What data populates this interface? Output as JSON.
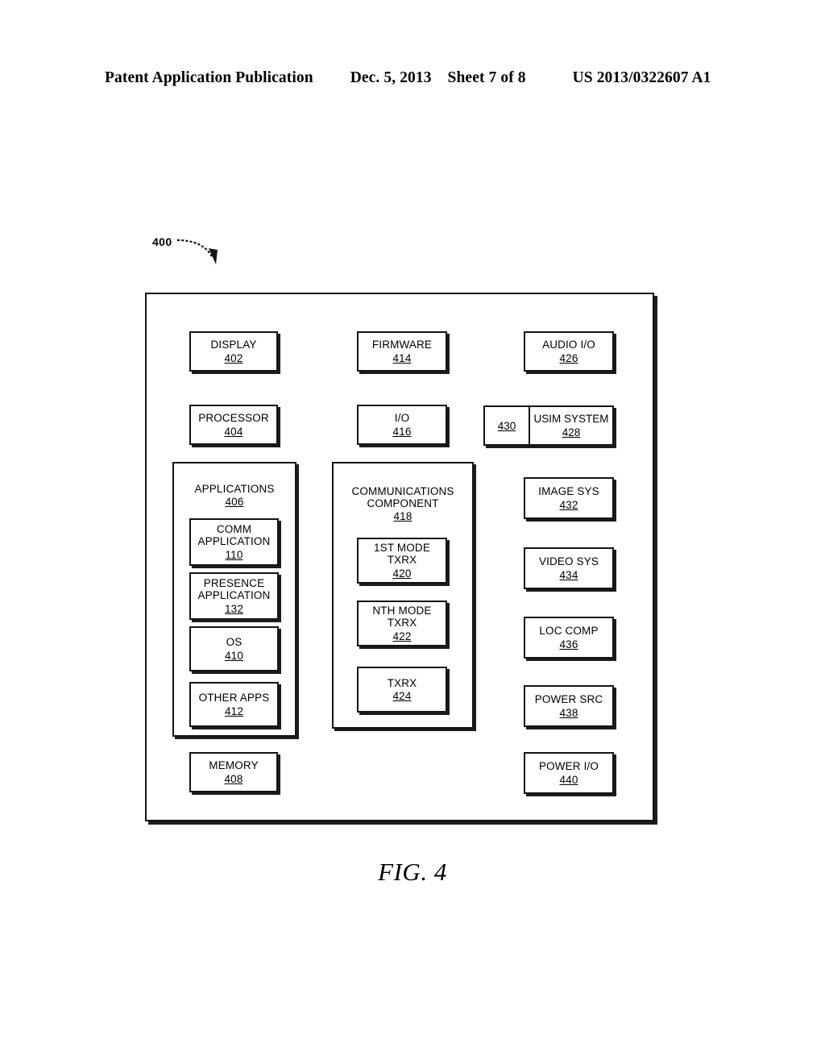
{
  "header": {
    "publication": "Patent Application Publication",
    "date": "Dec. 5, 2013",
    "sheet": "Sheet 7 of 8",
    "patent_number": "US 2013/0322607 A1"
  },
  "figure": {
    "caption": "FIG. 4",
    "ref_numeral": "400"
  },
  "blocks": {
    "display": {
      "label": "DISPLAY",
      "num": "402"
    },
    "processor": {
      "label": "PROCESSOR",
      "num": "404"
    },
    "memory": {
      "label": "MEMORY",
      "num": "408"
    },
    "firmware": {
      "label": "FIRMWARE",
      "num": "414"
    },
    "io": {
      "label": "I/O",
      "num": "416"
    },
    "audio_io": {
      "label": "AUDIO I/O",
      "num": "426"
    },
    "usim": {
      "label": "USIM SYSTEM",
      "num": "428",
      "side_num": "430"
    },
    "image_sys": {
      "label": "IMAGE SYS",
      "num": "432"
    },
    "video_sys": {
      "label": "VIDEO SYS",
      "num": "434"
    },
    "loc_comp": {
      "label": "LOC COMP",
      "num": "436"
    },
    "power_src": {
      "label": "POWER SRC",
      "num": "438"
    },
    "power_io": {
      "label": "POWER I/O",
      "num": "440"
    }
  },
  "applications_group": {
    "label": "APPLICATIONS",
    "num": "406",
    "items": [
      {
        "label": "COMM\nAPPLICATION",
        "num": "110"
      },
      {
        "label": "PRESENCE\nAPPLICATION",
        "num": "132"
      },
      {
        "label": "OS",
        "num": "410"
      },
      {
        "label": "OTHER APPS",
        "num": "412"
      }
    ]
  },
  "communications_group": {
    "label": "COMMUNICATIONS\nCOMPONENT",
    "num": "418",
    "items": [
      {
        "label": "1ST MODE\nTXRX",
        "num": "420"
      },
      {
        "label": "NTH MODE\nTXRX",
        "num": "422"
      },
      {
        "label": "TXRX",
        "num": "424"
      }
    ]
  },
  "colors": {
    "ink": "#141414",
    "shadow": "#1c1c1c",
    "paper": "#ffffff"
  }
}
